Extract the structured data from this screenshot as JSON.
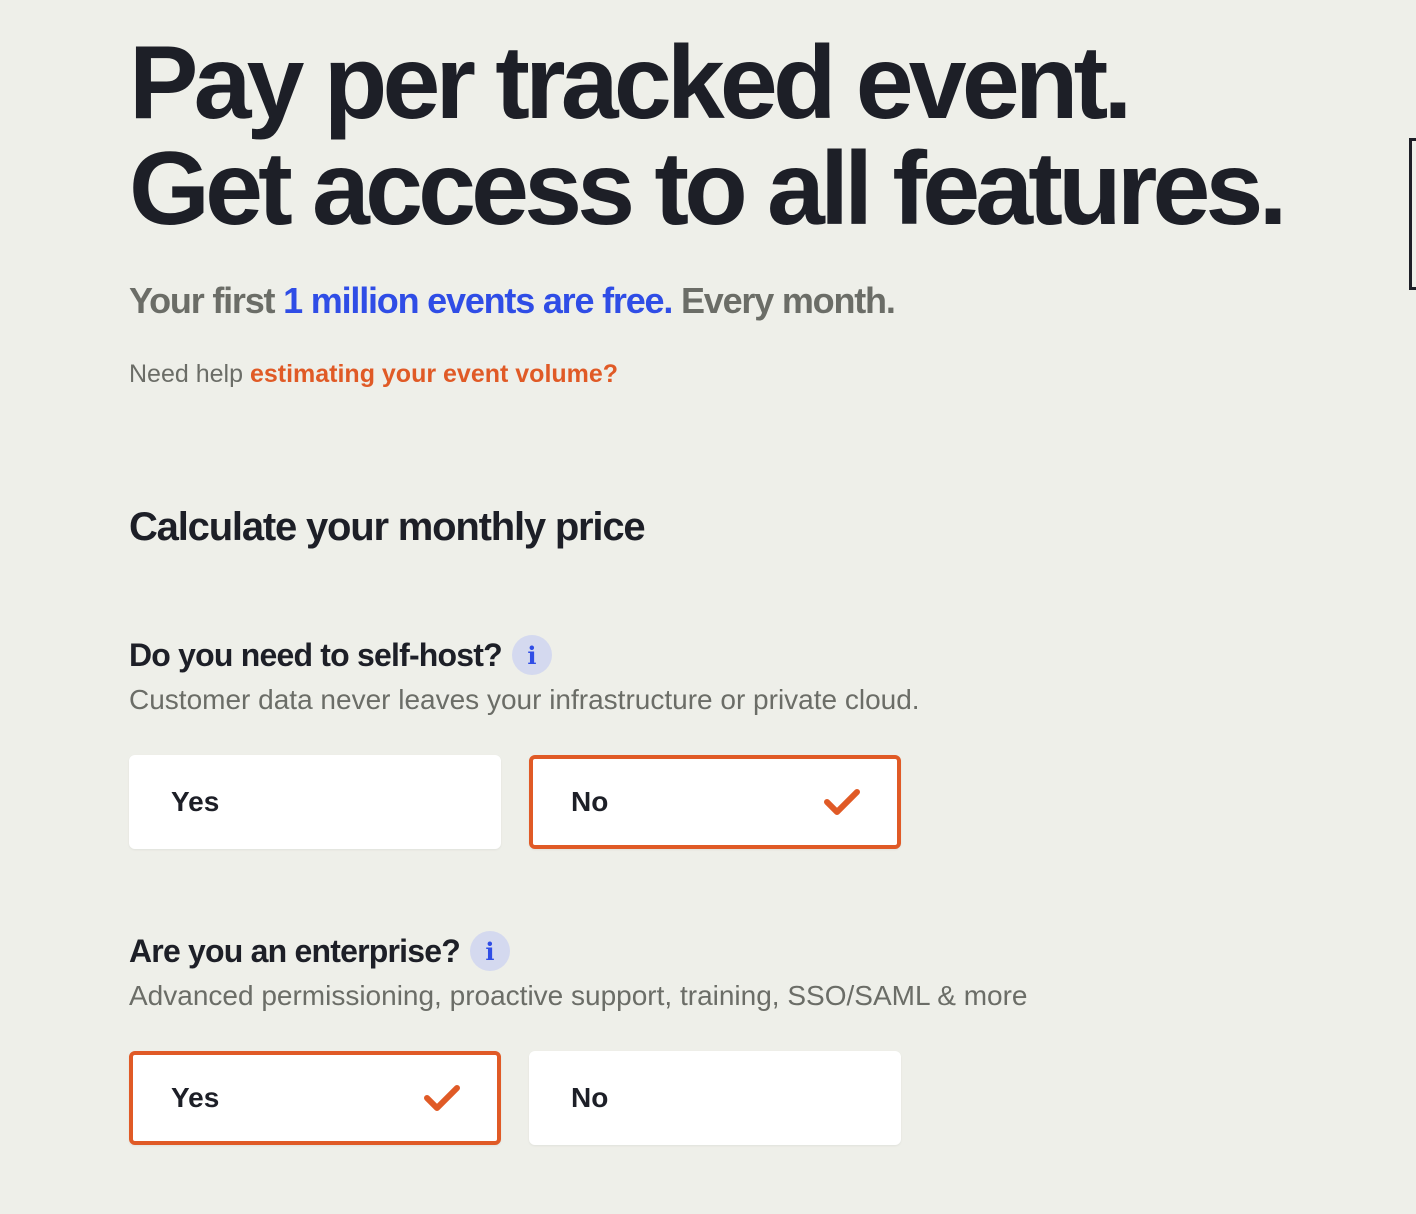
{
  "hero": {
    "line1": "Pay per tracked event.",
    "line2": "Get access to all features.",
    "subhead_prefix": "Your first ",
    "subhead_highlight": "1 million events are free.",
    "subhead_suffix": " Every month.",
    "help_prefix": "Need help ",
    "help_link": "estimating your event volume?"
  },
  "calculator": {
    "title": "Calculate your monthly price",
    "questions": [
      {
        "label": "Do you need to self-host?",
        "info_icon": "i",
        "description": "Customer data never leaves your infrastructure or private cloud.",
        "options": [
          {
            "label": "Yes",
            "selected": false
          },
          {
            "label": "No",
            "selected": true
          }
        ]
      },
      {
        "label": "Are you an enterprise?",
        "info_icon": "i",
        "description": "Advanced permissioning, proactive support, training, SSO/SAML & more",
        "options": [
          {
            "label": "Yes",
            "selected": true
          },
          {
            "label": "No",
            "selected": false
          }
        ]
      }
    ]
  },
  "colors": {
    "background": "#eeefe9",
    "accent_orange": "#e05a26",
    "accent_blue": "#2f4de6",
    "text_dark": "#1d1f27",
    "text_muted": "#6b6d67"
  },
  "icons": {
    "info": "info-icon",
    "check": "check-icon"
  }
}
